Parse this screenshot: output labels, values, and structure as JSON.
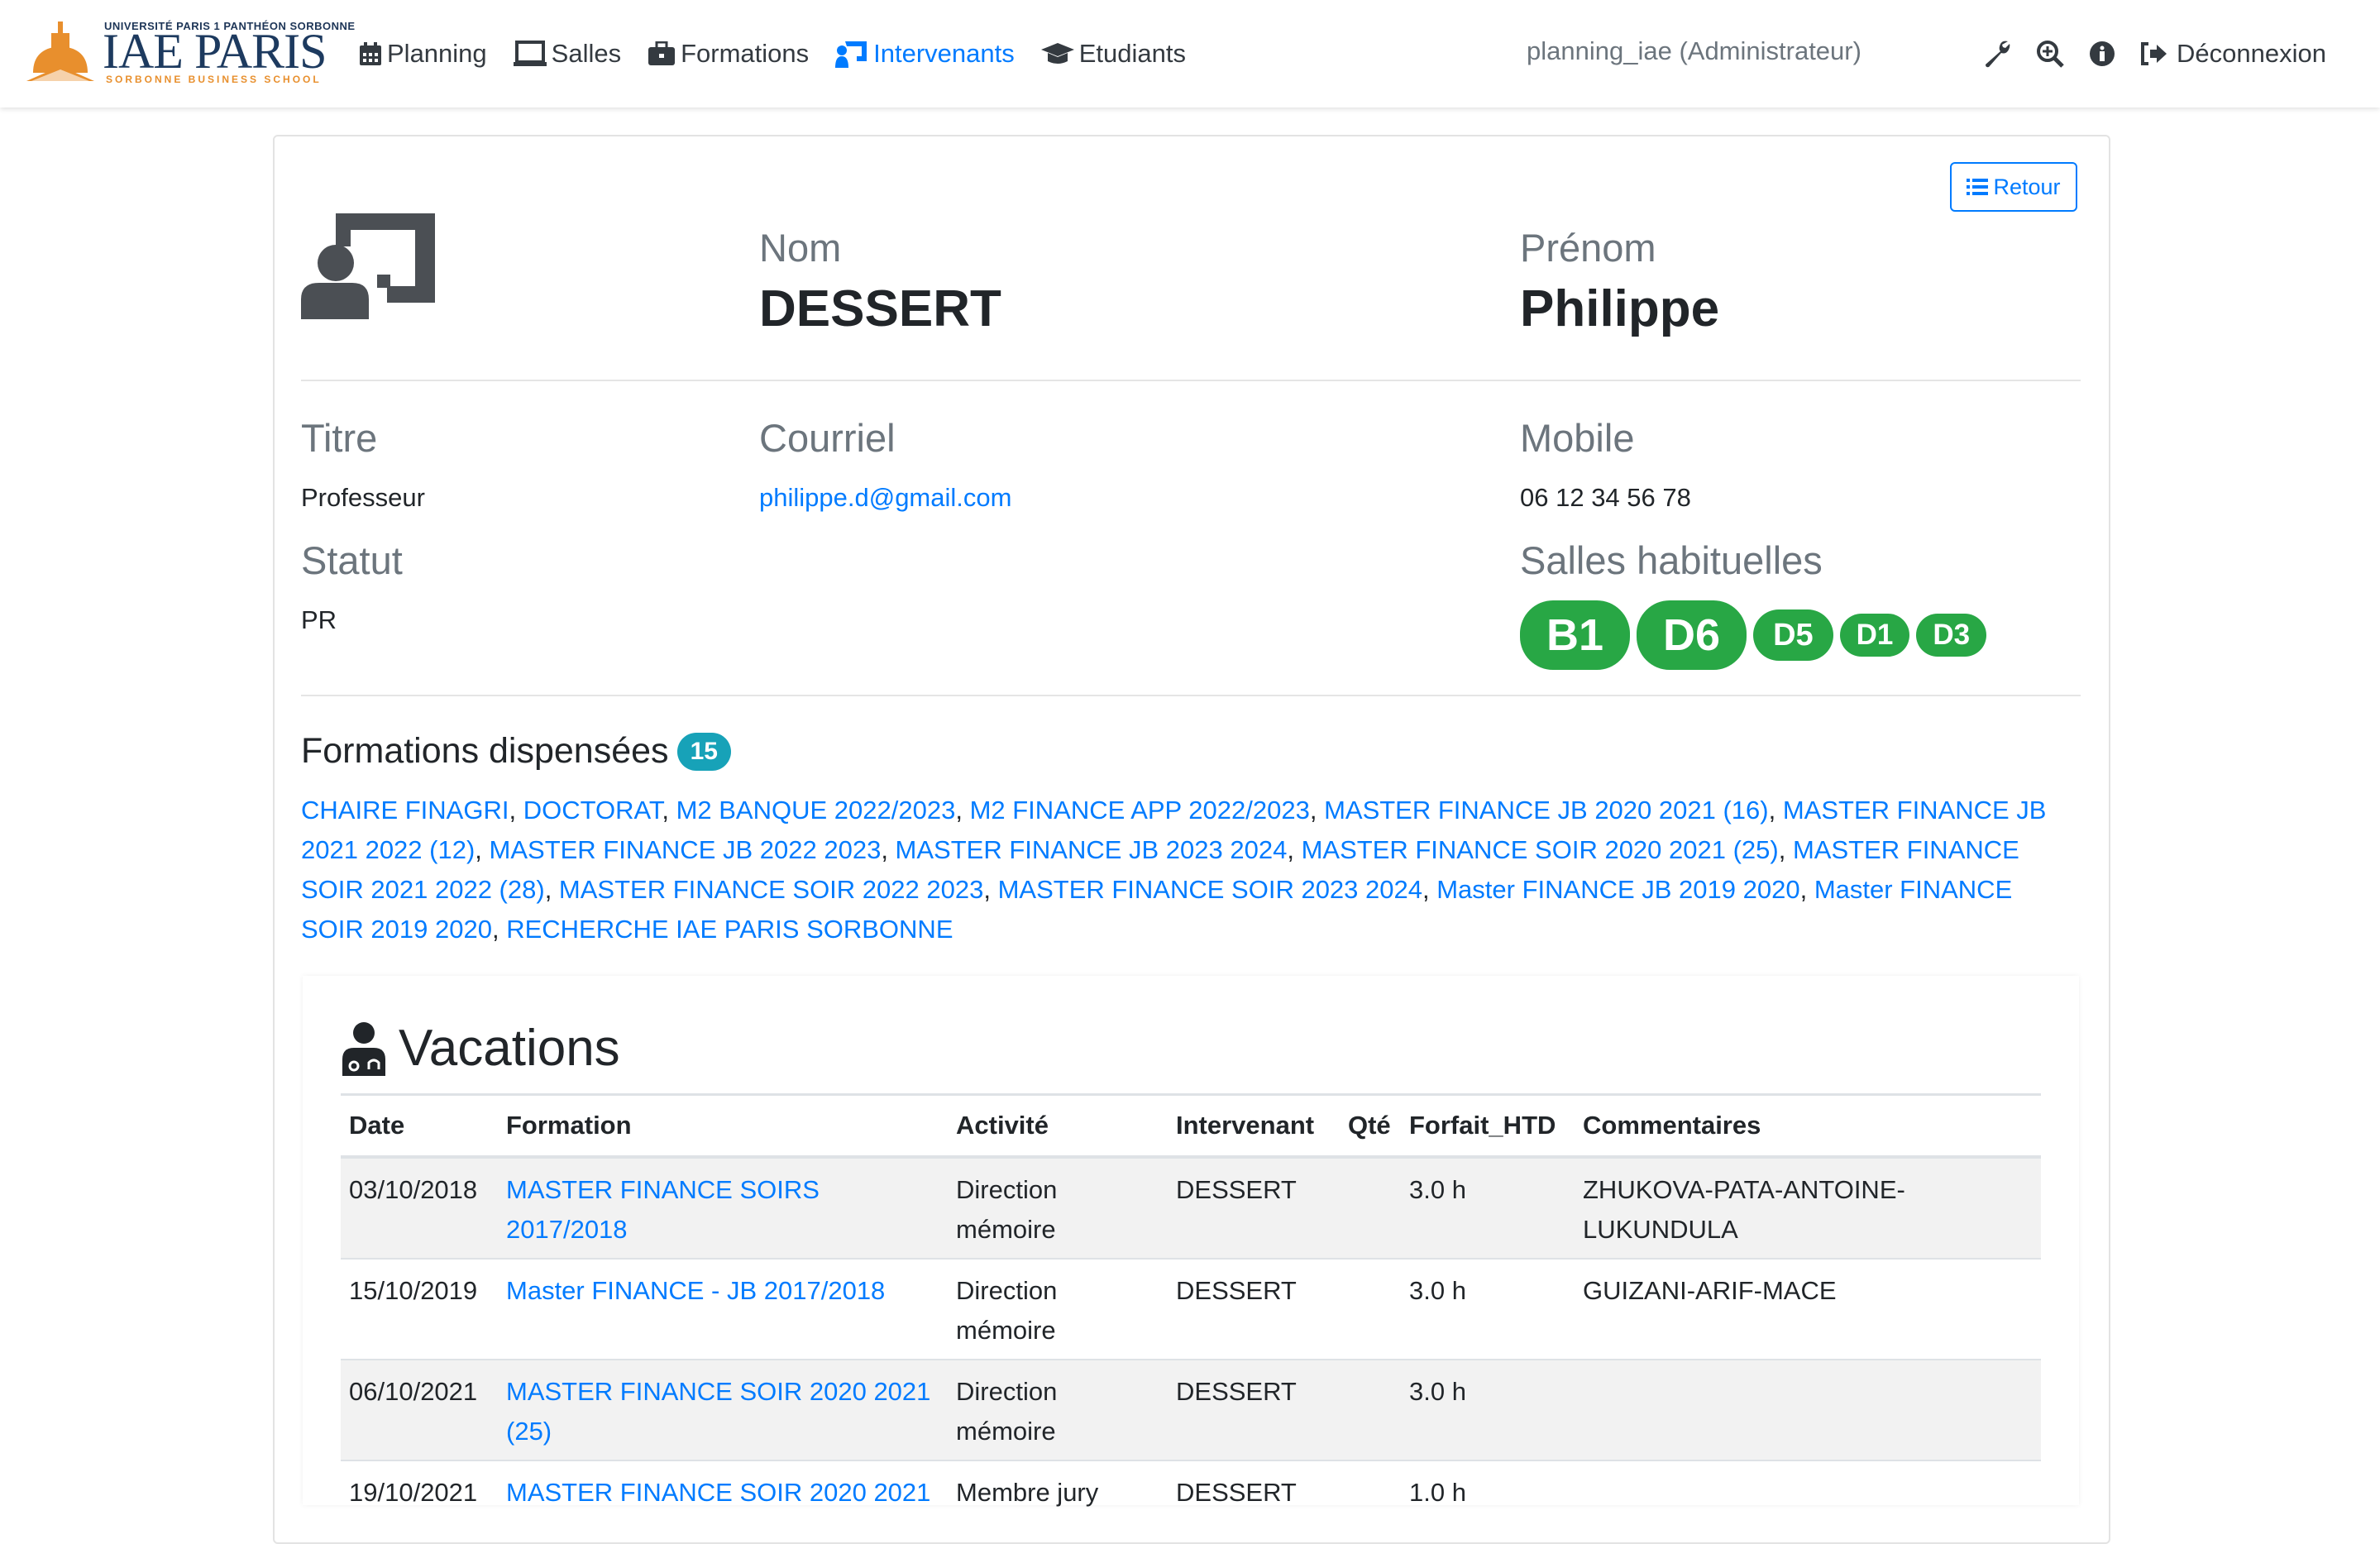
{
  "brand": {
    "university": "UNIVERSITÉ PARIS 1 PANTHÉON SORBONNE",
    "name": "IAE PARIS",
    "school": "SORBONNE BUSINESS SCHOOL",
    "accent_color": "#e88f2d"
  },
  "nav": {
    "items": [
      {
        "label": "Planning",
        "icon": "calendar-icon"
      },
      {
        "label": "Salles",
        "icon": "laptop-icon"
      },
      {
        "label": "Formations",
        "icon": "briefcase-icon"
      },
      {
        "label": "Intervenants",
        "icon": "chalkboard-teacher-icon",
        "active": true
      },
      {
        "label": "Etudiants",
        "icon": "graduation-cap-icon"
      }
    ],
    "user": "planning_iae (Administrateur)",
    "logout": "Déconnexion",
    "active_color": "#007bff"
  },
  "profile": {
    "retour": "Retour",
    "nom_label": "Nom",
    "nom": "DESSERT",
    "prenom_label": "Prénom",
    "prenom": "Philippe",
    "titre_label": "Titre",
    "titre": "Professeur",
    "courriel_label": "Courriel",
    "courriel": "philippe.d@gmail.com",
    "mobile_label": "Mobile",
    "mobile": "06 12 34 56 78",
    "statut_label": "Statut",
    "statut": "PR",
    "salles_label": "Salles habituelles",
    "salles": [
      "B1",
      "D6",
      "D5",
      "D1",
      "D3"
    ],
    "salle_color": "#28a745"
  },
  "formations": {
    "title": "Formations dispensées",
    "count": "15",
    "items": [
      "CHAIRE FINAGRI",
      "DOCTORAT",
      "M2 BANQUE 2022/2023",
      "M2 FINANCE APP 2022/2023",
      "MASTER FINANCE JB 2020 2021 (16)",
      "MASTER FINANCE JB 2021 2022 (12)",
      "MASTER FINANCE JB 2022 2023",
      "MASTER FINANCE JB 2023 2024",
      "MASTER FINANCE SOIR 2020 2021 (25)",
      "MASTER FINANCE SOIR 2021 2022 (28)",
      "MASTER FINANCE SOIR 2022 2023",
      "MASTER FINANCE SOIR 2023 2024",
      "Master FINANCE JB 2019 2020",
      "Master FINANCE SOIR 2019 2020",
      "RECHERCHE IAE PARIS SORBONNE"
    ]
  },
  "vacations": {
    "title": "Vacations",
    "columns": [
      "Date",
      "Formation",
      "Activité",
      "Intervenant",
      "Qté",
      "Forfait_HTD",
      "Commentaires"
    ],
    "rows": [
      {
        "date": "03/10/2018",
        "formation": "MASTER FINANCE SOIRS 2017/2018",
        "activite": "Direction mémoire",
        "intervenant": "DESSERT",
        "qte": "",
        "forfait": "3.0 h",
        "commentaires": "ZHUKOVA-PATA-ANTOINE-LUKUNDULA"
      },
      {
        "date": "15/10/2019",
        "formation": "Master FINANCE - JB 2017/2018",
        "activite": "Direction mémoire",
        "intervenant": "DESSERT",
        "qte": "",
        "forfait": "3.0 h",
        "commentaires": "GUIZANI-ARIF-MACE"
      },
      {
        "date": "06/10/2021",
        "formation": "MASTER FINANCE SOIR 2020 2021 (25)",
        "activite": "Direction mémoire",
        "intervenant": "DESSERT",
        "qte": "",
        "forfait": "3.0 h",
        "commentaires": ""
      },
      {
        "date": "19/10/2021",
        "formation": "MASTER FINANCE SOIR 2020 2021",
        "activite": "Membre jury",
        "intervenant": "DESSERT",
        "qte": "",
        "forfait": "1.0 h",
        "commentaires": ""
      }
    ]
  }
}
